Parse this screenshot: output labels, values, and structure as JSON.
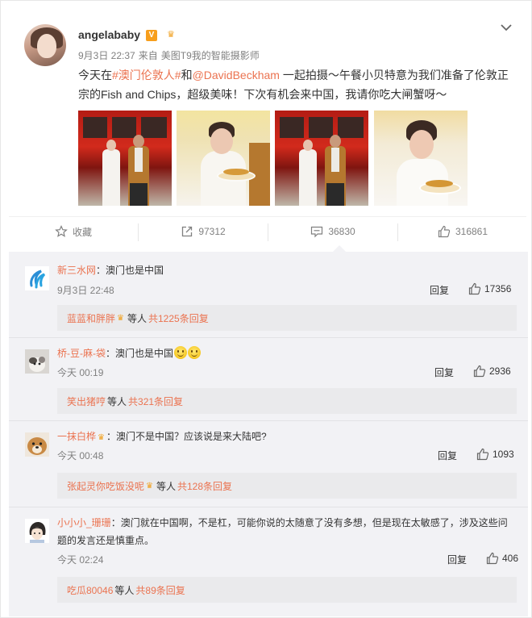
{
  "post": {
    "username": "angelababy",
    "date": "9月3日 22:37",
    "from_label": "来自",
    "source": "美图T9我的智能摄影师",
    "text_before": "今天在",
    "hashtag": "#澳门伦敦人#",
    "text_and": "和",
    "mention": "@DavidBeckham",
    "text_after": " 一起拍摄～午餐小贝特意为我们准备了伦敦正宗的Fish and Chips，超级美味！下次有机会来中国，我请你吃大闸蟹呀～",
    "vip_badge": "V",
    "icons": {
      "verified": "verified-v-icon",
      "member": "crown-icon",
      "more": "chevron-down-icon"
    }
  },
  "actions": {
    "favorite": "收藏",
    "repost": "97312",
    "comment": "36830",
    "like": "316861"
  },
  "comments": [
    {
      "name": "新三水网",
      "sep": "：",
      "text": "澳门也是中国",
      "time": "9月3日 22:48",
      "reply": "回复",
      "likes": "17356",
      "sub_user": "蓝蓝和胖胖",
      "sub_mid": "等人",
      "sub_count": "共1225条回复"
    },
    {
      "name": "桥-豆-麻-袋",
      "sep": "：",
      "text": "澳门也是中国",
      "time": "今天 00:19",
      "reply": "回复",
      "likes": "2936",
      "sub_user": "笑出猪哼",
      "sub_mid": "等人",
      "sub_count": "共321条回复"
    },
    {
      "name": "一抹白桦",
      "sep": "：",
      "text": "澳门不是中国？应该说是来大陆吧?",
      "time": "今天 00:48",
      "reply": "回复",
      "likes": "1093",
      "sub_user": "张起灵你吃饭没呢",
      "sub_mid": "等人",
      "sub_count": "共128条回复"
    },
    {
      "name": "小小小_珊珊",
      "sep": "：",
      "text": "澳门就在中国啊，不是杠，可能你说的太随意了没有多想，但是现在太敏感了，涉及这些问题的发言还是慎重点。",
      "time": "今天 02:24",
      "reply": "回复",
      "likes": "406",
      "sub_user": "吃瓜80046",
      "sub_mid": "等人",
      "sub_count": "共89条回复"
    }
  ],
  "colors": {
    "accent": "#eb7350",
    "muted": "#808080",
    "comment_bg": "#f2f2f5",
    "vip": "#f79e1c"
  }
}
